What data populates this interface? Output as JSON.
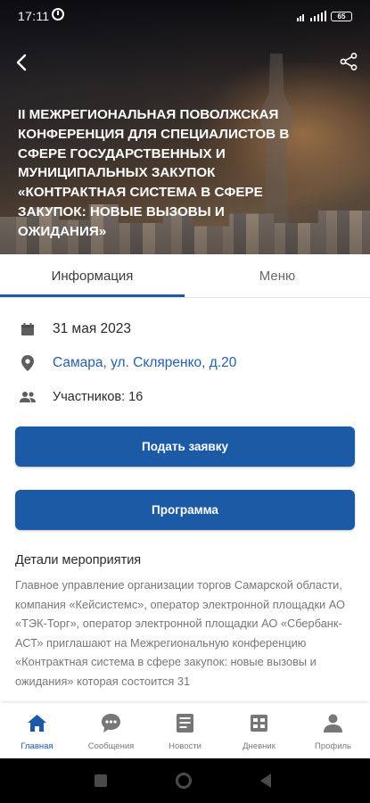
{
  "status_bar": {
    "time": "17:11",
    "battery": "65"
  },
  "hero": {
    "title": "II МЕЖРЕГИОНАЛЬНАЯ ПОВОЛЖСКАЯ КОНФЕРЕНЦИЯ  ДЛЯ СПЕЦИАЛИСТОВ В СФЕРЕ ГОСУДАРСТВЕННЫХ  И МУНИЦИПАЛЬНЫХ ЗАКУПОК «КОНТРАКТНАЯ СИСТЕМА  В СФЕРЕ ЗАКУПОК: НОВЫЕ ВЫЗОВЫ И ОЖИДАНИЯ»",
    "back_icon": "arrow-back-icon",
    "share_icon": "share-icon"
  },
  "tabs": [
    {
      "label": "Информация",
      "active": true
    },
    {
      "label": "Меню",
      "active": false
    }
  ],
  "event": {
    "date": "31 мая  2023",
    "address": "Самара, ул. Скляренко, д.20",
    "participants": "Участников: 16",
    "date_icon": "calendar-icon",
    "address_icon": "location-pin-icon",
    "participants_icon": "people-icon"
  },
  "buttons": {
    "apply": "Подать заявку",
    "program": "Программа"
  },
  "details": {
    "title": "Детали мероприятия",
    "text": "Главное управление организации торгов Самарской области, компания «Кейсистемс», оператор электронной площадки АО «ТЭК-Торг», оператор электронной площадки АО «Сбербанк-АСТ» приглашают на Межрегиональную конференцию  «Контрактная система в сфере закупок: новые вызовы и ожидания»  которая состоится 31"
  },
  "bottom_nav": [
    {
      "label": "Главная",
      "icon": "home-icon",
      "active": true
    },
    {
      "label": "Сообщения",
      "icon": "chat-icon",
      "active": false
    },
    {
      "label": "Новости",
      "icon": "news-icon",
      "active": false
    },
    {
      "label": "Дневник",
      "icon": "diary-icon",
      "active": false
    },
    {
      "label": "Профиль",
      "icon": "profile-icon",
      "active": false
    }
  ],
  "colors": {
    "accent": "#1c5aa6",
    "text": "#2a2a2a",
    "muted": "#777777"
  }
}
